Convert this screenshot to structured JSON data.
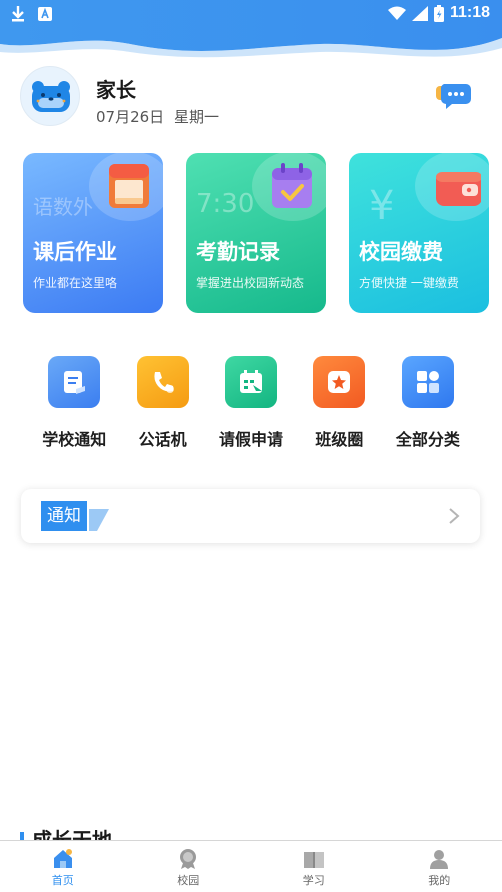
{
  "status_bar": {
    "time": "11:18"
  },
  "header": {
    "name": "家长",
    "date": "07月26日",
    "weekday": "星期一"
  },
  "cards": [
    {
      "title": "课后作业",
      "subtitle": "作业都在这里咯",
      "ghost_text": "语数外",
      "icon": "notebook-icon",
      "gradient": [
        "#6fb2ff",
        "#3a78f2"
      ]
    },
    {
      "title": "考勤记录",
      "subtitle": "掌握进出校园新动态",
      "ghost_text": "7:30",
      "icon": "calendar-check-icon",
      "gradient": [
        "#4fe0b2",
        "#16b98c"
      ]
    },
    {
      "title": "校园缴费",
      "subtitle": "方便快捷 一键缴费",
      "ghost_text": "¥",
      "icon": "wallet-icon",
      "gradient": [
        "#3fe2dc",
        "#1bbfe0"
      ]
    }
  ],
  "shortcuts": [
    {
      "label": "学校通知",
      "icon": "school-notice-icon",
      "color": "#4b8ff3"
    },
    {
      "label": "公话机",
      "icon": "phone-icon",
      "color": "#f7a81b"
    },
    {
      "label": "请假申请",
      "icon": "leave-calendar-icon",
      "color": "#1ec58d"
    },
    {
      "label": "班级圈",
      "icon": "class-circle-star-icon",
      "color": "#f46a2a"
    },
    {
      "label": "全部分类",
      "icon": "all-categories-icon",
      "color": "#3b82f6"
    }
  ],
  "notice": {
    "tag": "通知"
  },
  "section_title": "成长天地",
  "tabs": [
    {
      "label": "首页",
      "icon": "home-icon",
      "active": true
    },
    {
      "label": "校园",
      "icon": "campus-badge-icon",
      "active": false
    },
    {
      "label": "学习",
      "icon": "book-icon",
      "active": false
    },
    {
      "label": "我的",
      "icon": "user-icon",
      "active": false
    }
  ],
  "colors": {
    "accent": "#2f8fef",
    "wave": "#3d95ef"
  }
}
